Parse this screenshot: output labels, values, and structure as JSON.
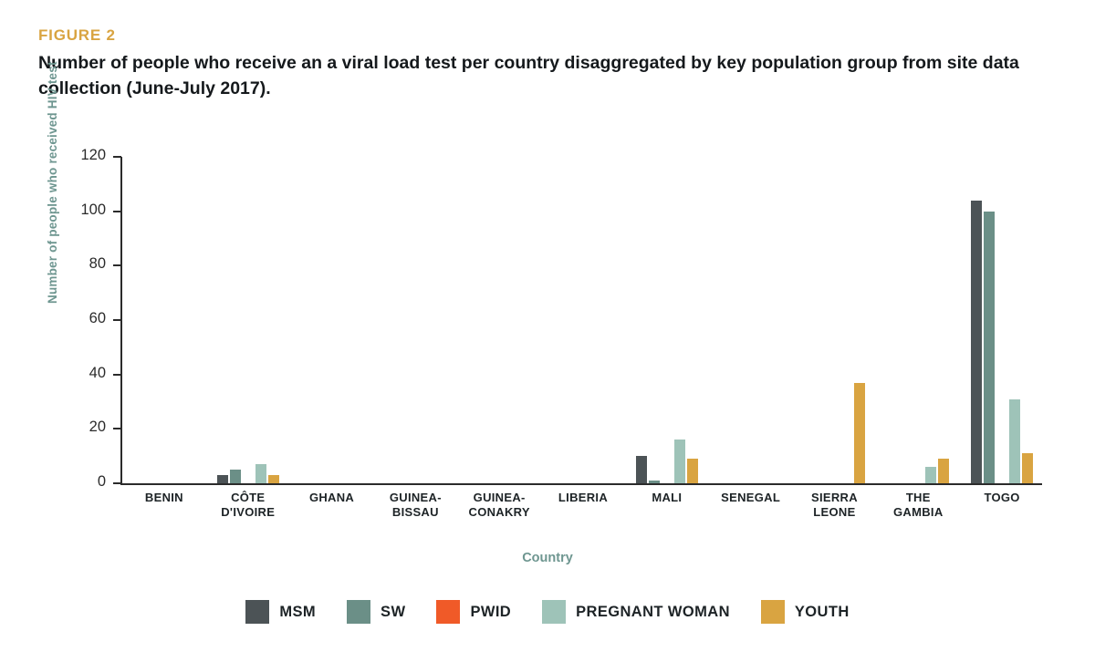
{
  "figure": {
    "label": "FIGURE 2",
    "title": "Number of people who receive an a viral load test per country disaggregated by key population group from site data collection (June-July 2017)."
  },
  "colors": {
    "figure_label": "#d9a441",
    "axis_label": "#6e9690",
    "msm": "#4c5356",
    "sw": "#6b8f87",
    "pwid": "#f05a28",
    "pregnant_woman": "#9ec3b8",
    "youth": "#d9a441"
  },
  "chart_data": {
    "type": "bar",
    "title": "Number of people who receive an a viral load test per country disaggregated by key population group from site data collection (June-July 2017).",
    "xlabel": "Country",
    "ylabel": "Number of people who received HIV test",
    "ylim": [
      0,
      120
    ],
    "yticks": [
      0,
      20,
      40,
      60,
      80,
      100,
      120
    ],
    "grid": false,
    "legend_position": "bottom",
    "categories": [
      "BENIN",
      "CÔTE D'IVOIRE",
      "GHANA",
      "GUINEA-BISSAU",
      "GUINEA-CONAKRY",
      "LIBERIA",
      "MALI",
      "SENEGAL",
      "SIERRA LEONE",
      "THE GAMBIA",
      "TOGO"
    ],
    "category_lines": [
      [
        "BENIN"
      ],
      [
        "CÔTE",
        "D'IVOIRE"
      ],
      [
        "GHANA"
      ],
      [
        "GUINEA-",
        "BISSAU"
      ],
      [
        "GUINEA-",
        "CONAKRY"
      ],
      [
        "LIBERIA"
      ],
      [
        "MALI"
      ],
      [
        "SENEGAL"
      ],
      [
        "SIERRA",
        "LEONE"
      ],
      [
        "THE",
        "GAMBIA"
      ],
      [
        "TOGO"
      ]
    ],
    "series": [
      {
        "name": "MSM",
        "color": "#4c5356",
        "values": [
          0,
          3,
          0,
          0,
          0,
          0,
          10,
          0,
          0,
          0,
          104
        ]
      },
      {
        "name": "SW",
        "color": "#6b8f87",
        "values": [
          0,
          5,
          0,
          0,
          0,
          0,
          1,
          0,
          0,
          0,
          100
        ]
      },
      {
        "name": "PWID",
        "color": "#f05a28",
        "values": [
          0,
          0,
          0,
          0,
          0,
          0,
          0,
          0,
          0,
          0,
          0
        ]
      },
      {
        "name": "PREGNANT WOMAN",
        "color": "#9ec3b8",
        "values": [
          0,
          7,
          0,
          0,
          0,
          0,
          16,
          0,
          0,
          6,
          31
        ]
      },
      {
        "name": "YOUTH",
        "color": "#d9a441",
        "values": [
          0,
          3,
          0,
          0,
          0,
          0,
          9,
          0,
          37,
          9,
          11
        ]
      }
    ]
  }
}
